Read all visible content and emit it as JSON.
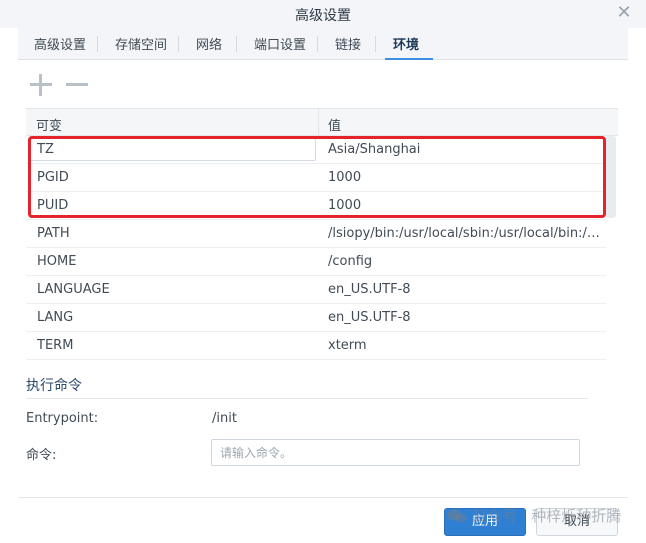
{
  "window": {
    "title": "高级设置"
  },
  "tabs": [
    {
      "label": "高级设置",
      "active": false
    },
    {
      "label": "存储空间",
      "active": false
    },
    {
      "label": "网络",
      "active": false
    },
    {
      "label": "端口设置",
      "active": false
    },
    {
      "label": "链接",
      "active": false
    },
    {
      "label": "环境",
      "active": true
    }
  ],
  "toolbar": {
    "add_icon": "plus-icon",
    "remove_icon": "minus-icon"
  },
  "grid": {
    "columns": [
      "可变",
      "值"
    ],
    "rows": [
      {
        "key": "TZ",
        "value": "Asia/Shanghai"
      },
      {
        "key": "PGID",
        "value": "1000"
      },
      {
        "key": "PUID",
        "value": "1000"
      },
      {
        "key": "PATH",
        "value": "/lsiopy/bin:/usr/local/sbin:/usr/local/bin:/u..."
      },
      {
        "key": "HOME",
        "value": "/config"
      },
      {
        "key": "LANGUAGE",
        "value": "en_US.UTF-8"
      },
      {
        "key": "LANG",
        "value": "en_US.UTF-8"
      },
      {
        "key": "TERM",
        "value": "xterm"
      }
    ]
  },
  "exec": {
    "section_title": "执行命令",
    "entrypoint_label": "Entrypoint:",
    "entrypoint_value": "/init",
    "command_label": "命令:",
    "command_placeholder": "请输入命令。",
    "command_value": ""
  },
  "footer": {
    "apply_label": "应用",
    "cancel_label": "取消"
  },
  "watermark": {
    "text": "公众号 · 种梓烁种折腾"
  },
  "colors": {
    "accent": "#2f7fd3",
    "highlight": "#e5232a",
    "tab_underline": "#3b8ee3"
  }
}
